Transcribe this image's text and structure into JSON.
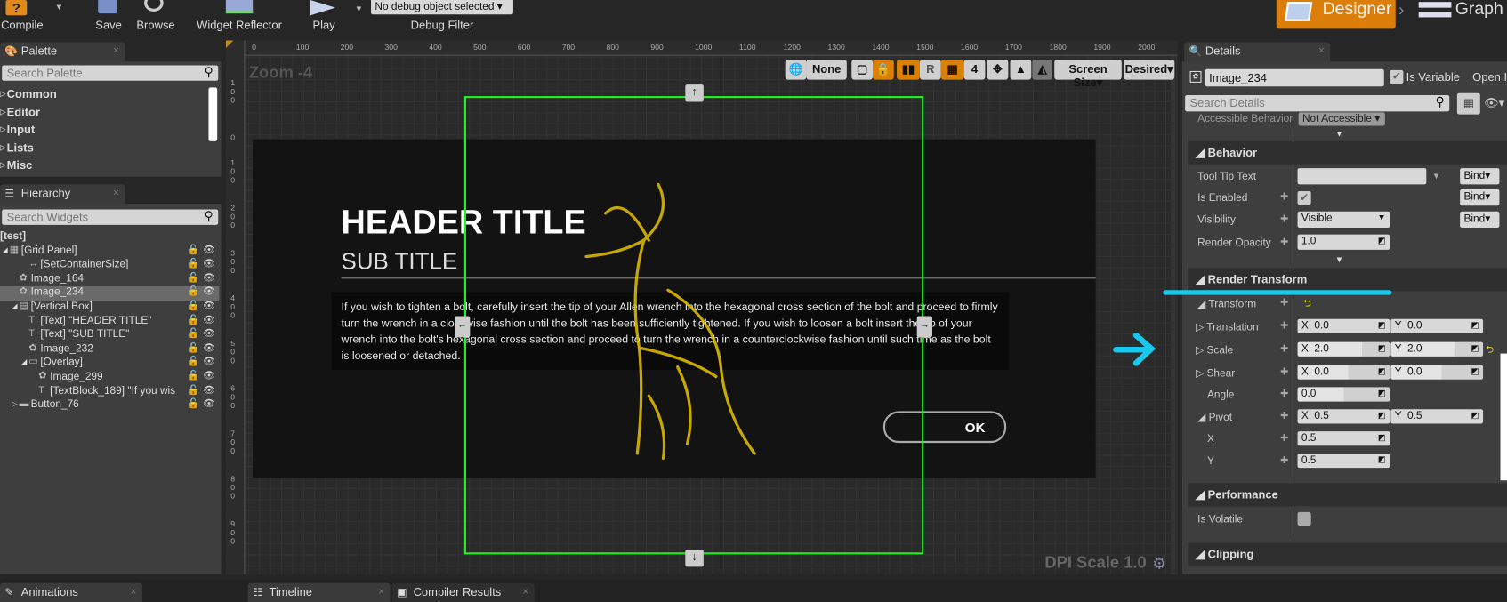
{
  "toolbar": {
    "compile": "Compile",
    "save": "Save",
    "browse": "Browse",
    "widget_reflector": "Widget Reflector",
    "play": "Play",
    "debug_select": "No debug object selected",
    "debug_filter": "Debug Filter",
    "designer": "Designer",
    "graph": "Graph"
  },
  "palette": {
    "tab": "Palette",
    "search_placeholder": "Search Palette",
    "categories": [
      "Common",
      "Editor",
      "Input",
      "Lists",
      "Misc"
    ]
  },
  "hierarchy": {
    "tab": "Hierarchy",
    "search_placeholder": "Search Widgets",
    "items": [
      {
        "label": "[test]",
        "expanded": true
      },
      {
        "label": "[Grid Panel]",
        "expanded": true
      },
      {
        "label": "[SetContainerSize]"
      },
      {
        "label": "Image_164"
      },
      {
        "label": "Image_234",
        "selected": true
      },
      {
        "label": "[Vertical Box]",
        "expanded": true
      },
      {
        "label": "[Text] \"HEADER TITLE\""
      },
      {
        "label": "[Text] \"SUB TITLE\""
      },
      {
        "label": "Image_232"
      },
      {
        "label": "[Overlay]",
        "expanded": true
      },
      {
        "label": "Image_299"
      },
      {
        "label": "[TextBlock_189] \"If you wis"
      },
      {
        "label": "Button_76",
        "expanded": false
      }
    ]
  },
  "canvas": {
    "zoom": "Zoom -4",
    "dpi": "DPI Scale 1.0",
    "ruler_top": [
      "0",
      "100",
      "200",
      "300",
      "400",
      "500",
      "600",
      "700",
      "800",
      "900",
      "1000",
      "1100",
      "1200",
      "1300",
      "1400",
      "1500",
      "1600",
      "1700",
      "1800",
      "1900",
      "2000"
    ],
    "ruler_left": [
      "100",
      "0",
      "100",
      "200",
      "300",
      "400",
      "500",
      "600",
      "700",
      "800",
      "900"
    ],
    "tools": {
      "none": "None",
      "r": "R",
      "grid": "4",
      "screen_size": "Screen Size",
      "desired": "Desired"
    },
    "widget": {
      "header": "HEADER TITLE",
      "subtitle": "SUB TITLE",
      "body": "If you wish to tighten a bolt, carefully insert the tip of your Allen wrench into the hexagonal cross section of the bolt and proceed to firmly turn the wrench in a clockwise fashion until the bolt has been sufficiently tightened. If you wish to loosen a bolt insert the tip of your wrench into the bolt's hexagonal cross section and proceed to turn the wrench in a counterclockwise fashion until such time as the bolt is loosened or detached.",
      "ok": "OK"
    },
    "colors": {
      "selection": "#22ee22",
      "deer": "#e8c400",
      "annotation": "#19c8ee"
    }
  },
  "details": {
    "tab": "Details",
    "name": "Image_234",
    "is_variable_label": "Is Variable",
    "is_variable": true,
    "open_in": "Open In",
    "search_placeholder": "Search Details",
    "accessible_behavior": "Accessible Behavior",
    "accessible_value": "Not Accessible",
    "behavior": {
      "title": "Behavior",
      "tooltip": "Tool Tip Text",
      "is_enabled": "Is Enabled",
      "visibility": "Visibility",
      "visibility_value": "Visible",
      "opacity": "Render Opacity",
      "opacity_value": "1.0",
      "bind": "Bind"
    },
    "render_transform": {
      "title": "Render Transform",
      "transform": "Transform",
      "translation": "Translation",
      "tx": "0.0",
      "ty": "0.0",
      "scale": "Scale",
      "sx": "2.0",
      "sy": "2.0",
      "shear": "Shear",
      "shx": "0.0",
      "shy": "0.0",
      "angle": "Angle",
      "angle_value": "0.0",
      "pivot": "Pivot",
      "px": "0.5",
      "py": "0.5",
      "x": "X",
      "y": "Y"
    },
    "performance": {
      "title": "Performance",
      "is_volatile": "Is Volatile"
    },
    "clipping": {
      "title": "Clipping"
    }
  },
  "bottom_tabs": [
    "Animations",
    "Timeline",
    "Compiler Results"
  ]
}
